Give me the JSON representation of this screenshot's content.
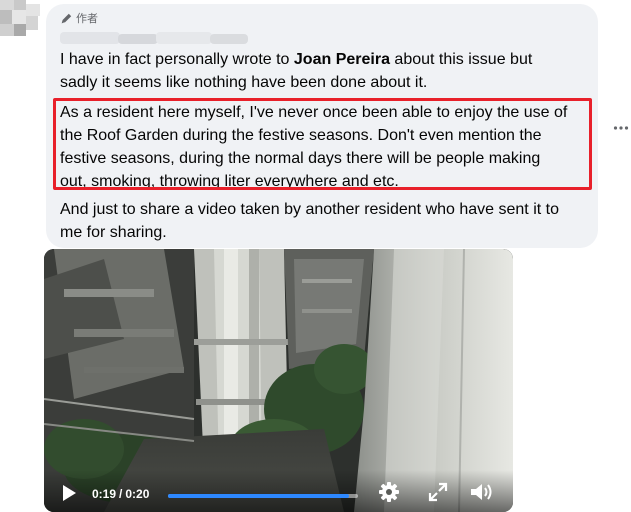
{
  "comment": {
    "author_badge": "作者",
    "paragraphs": [
      {
        "before": "I have in fact personally wrote to ",
        "bold": "Joan Pereira",
        "after": " about this issue but\nsadly it seems like nothing have been done about it."
      },
      {
        "before": "As a resident here myself, I've never once been able to enjoy the use of\nthe Roof Garden during the festive seasons. Don't even mention the\nfestive seasons, during the normal days there will be people making\nout, smoking, throwing liter everywhere and etc.",
        "bold": "",
        "after": ""
      },
      {
        "before": "And just to share a video taken by another resident who have sent it to\nme for sharing.",
        "bold": "",
        "after": ""
      }
    ]
  },
  "video": {
    "current_time": "0:19",
    "separator": "/",
    "duration": "0:20",
    "progress_fraction": 0.95
  },
  "colors": {
    "highlight_box": "#e8202a",
    "bubble_bg": "#f0f2f5",
    "progress_fill": "#2d88ff"
  },
  "icons": [
    "pencil-icon",
    "more-options-icon",
    "play-icon",
    "settings-gear-icon",
    "fullscreen-icon",
    "volume-icon"
  ]
}
